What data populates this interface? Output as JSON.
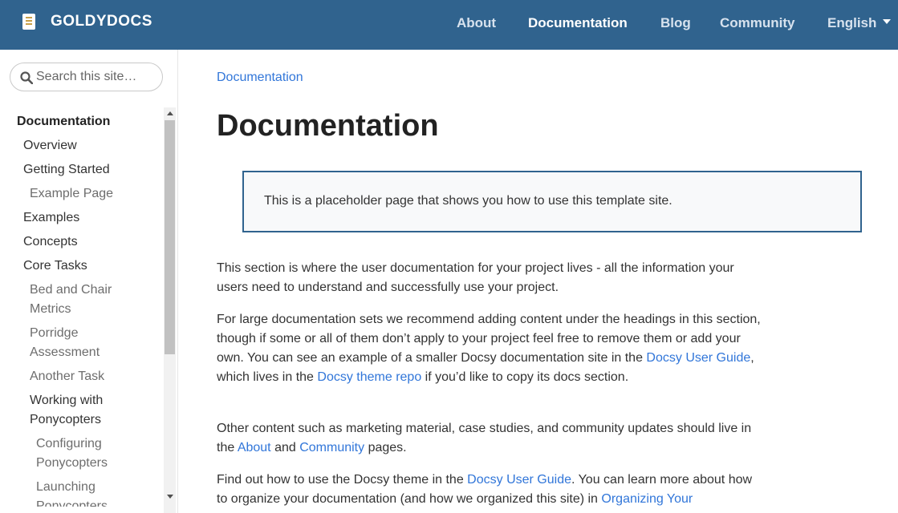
{
  "brand": {
    "name": "GOLDYDOCS"
  },
  "nav": {
    "about": "About",
    "documentation": "Documentation",
    "blog": "Blog",
    "community": "Community",
    "language": "English"
  },
  "search": {
    "placeholder": "Search this site…"
  },
  "sidebar": {
    "items": [
      "Documentation",
      "Overview",
      "Getting Started",
      "Example Page",
      "Examples",
      "Concepts",
      "Core Tasks",
      "Bed and Chair",
      "Metrics",
      "Porridge",
      "Assessment",
      "Another Task",
      "Working with",
      "Ponycopters",
      "Configuring",
      "Ponycopters",
      "Launching",
      "Ponycopters"
    ]
  },
  "main": {
    "breadcrumb": "Documentation",
    "title": "Documentation",
    "callout": "This is a placeholder page that shows you how to use this template site.",
    "p1": "This section is where the user documentation for your project lives - all the information your users need to understand and successfully use your project.",
    "p2": {
      "text1": "For large documentation sets we recommend adding content under the headings in this section, though if some or all of them don’t apply to your project feel free to remove them or add your own. You can see an example of a smaller Docsy documentation site in the ",
      "link1": "Docsy User Guide",
      "text2": ", which lives in the ",
      "link2": "Docsy theme repo",
      "text3": " if you’d like to copy its docs section."
    },
    "p3": {
      "text1": "Other content such as marketing material, case studies, and community updates should live in the ",
      "link1": "About",
      "text2": " and ",
      "link2": "Community",
      "text3": " pages."
    },
    "p4": {
      "text1": "Find out how to use the Docsy theme in the ",
      "link1": "Docsy User Guide",
      "text2": ". You can learn more about how to organize your documentation (and how we organized this site) in ",
      "link2": "Organizing Your"
    }
  }
}
